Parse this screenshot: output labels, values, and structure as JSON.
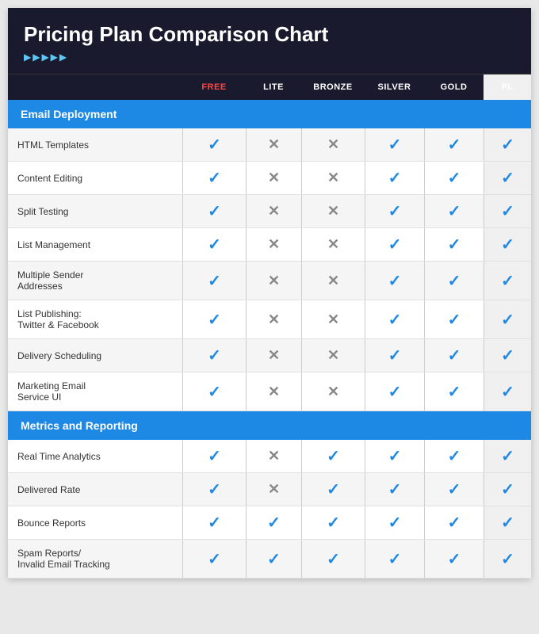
{
  "header": {
    "title": "Pricing Plan Comparison Chart",
    "arrows": "▶▶▶▶▶"
  },
  "columns": {
    "feature": "",
    "free": "FREE",
    "lite": "LITE",
    "bronze": "BRONZE",
    "silver": "SILVER",
    "gold": "GOLD",
    "pl": "PL"
  },
  "sections": [
    {
      "title": "Email Deployment",
      "rows": [
        {
          "name": "HTML Templates",
          "free": "check",
          "lite": "cross",
          "bronze": "cross",
          "silver": "check",
          "gold": "check",
          "pl": "check"
        },
        {
          "name": "Content Editing",
          "free": "check",
          "lite": "cross",
          "bronze": "cross",
          "silver": "check",
          "gold": "check",
          "pl": "check"
        },
        {
          "name": "Split Testing",
          "free": "check",
          "lite": "cross",
          "bronze": "cross",
          "silver": "check",
          "gold": "check",
          "pl": "check"
        },
        {
          "name": "List Management",
          "free": "check",
          "lite": "cross",
          "bronze": "cross",
          "silver": "check",
          "gold": "check",
          "pl": "check"
        },
        {
          "name": "Multiple Sender\nAddresses",
          "free": "check",
          "lite": "cross",
          "bronze": "cross",
          "silver": "check",
          "gold": "check",
          "pl": "check"
        },
        {
          "name": "List Publishing:\nTwitter & Facebook",
          "free": "check",
          "lite": "cross",
          "bronze": "cross",
          "silver": "check",
          "gold": "check",
          "pl": "check"
        },
        {
          "name": "Delivery Scheduling",
          "free": "check",
          "lite": "cross",
          "bronze": "cross",
          "silver": "check",
          "gold": "check",
          "pl": "check"
        },
        {
          "name": "Marketing Email\nService UI",
          "free": "check",
          "lite": "cross",
          "bronze": "cross",
          "silver": "check",
          "gold": "check",
          "pl": "check"
        }
      ]
    },
    {
      "title": "Metrics and Reporting",
      "rows": [
        {
          "name": "Real Time Analytics",
          "free": "check",
          "lite": "cross",
          "bronze": "check",
          "silver": "check",
          "gold": "check",
          "pl": "check"
        },
        {
          "name": "Delivered Rate",
          "free": "check",
          "lite": "cross",
          "bronze": "check",
          "silver": "check",
          "gold": "check",
          "pl": "check"
        },
        {
          "name": "Bounce Reports",
          "free": "check",
          "lite": "check",
          "bronze": "check",
          "silver": "check",
          "gold": "check",
          "pl": "check"
        },
        {
          "name": "Spam Reports/\nInvalid Email Tracking",
          "free": "check",
          "lite": "check",
          "bronze": "check",
          "silver": "check",
          "gold": "check",
          "pl": "check"
        }
      ]
    }
  ]
}
